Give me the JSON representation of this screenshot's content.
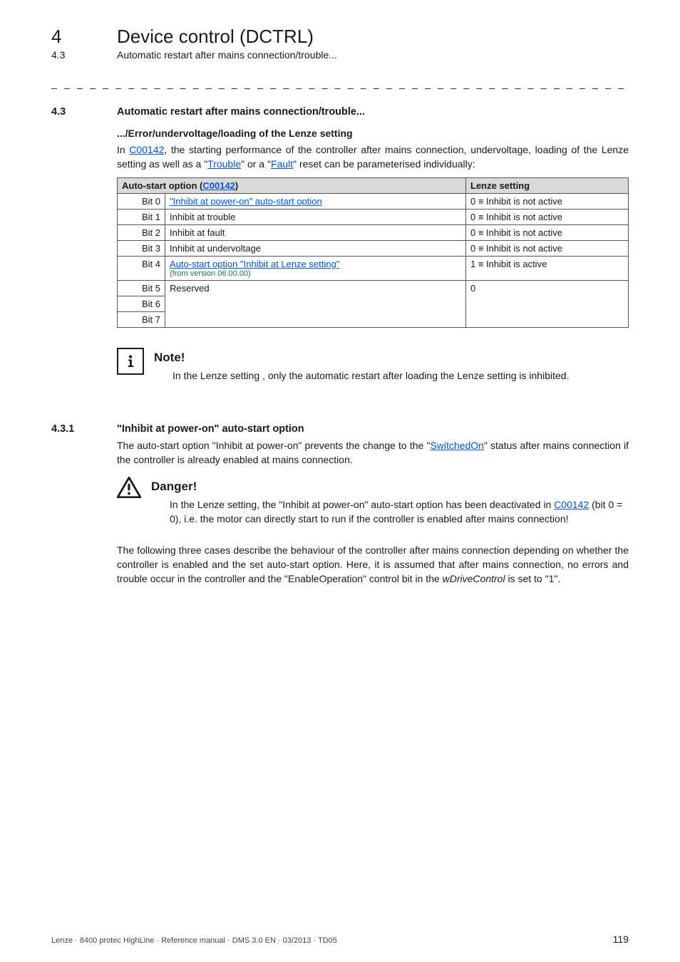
{
  "chapter": {
    "number": "4",
    "title": "Device control (DCTRL)"
  },
  "header_sub": {
    "number": "4.3",
    "title": "Automatic restart after mains connection/trouble..."
  },
  "dash_rule": "_ _ _ _ _ _ _ _ _ _ _ _ _ _ _ _ _ _ _ _ _ _ _ _ _ _ _ _ _ _ _ _ _ _ _ _ _ _ _ _ _ _ _ _ _ _ _ _ _ _ _ _ _ _ _ _ _ _ _ _ _ _ _ _",
  "section_4_3": {
    "num": "4.3",
    "title": "Automatic restart after mains connection/trouble...",
    "subheading": ".../Error/undervoltage/loading of the Lenze setting",
    "intro_pre": "In ",
    "intro_link1": "C00142",
    "intro_mid1": ", the starting performance of the controller after mains connection, undervoltage, loading of the Lenze setting as well as a \"",
    "intro_link2": "Trouble",
    "intro_mid2": "\" or a \"",
    "intro_link3": "Fault",
    "intro_post": "\" reset can be parameterised individually:"
  },
  "table": {
    "hdr_left_pre": "Auto-start option (",
    "hdr_left_link": "C00142",
    "hdr_left_post": ")",
    "hdr_right": "Lenze setting",
    "rows": {
      "r0": {
        "bit": "Bit 0",
        "desc_link": "\"Inhibit at power-on\" auto-start option",
        "setting": "0 ≡ Inhibit is not active"
      },
      "r1": {
        "bit": "Bit 1",
        "desc": "Inhibit at trouble",
        "setting": "0 ≡ Inhibit is not active"
      },
      "r2": {
        "bit": "Bit 2",
        "desc": "Inhibit at fault",
        "setting": "0 ≡ Inhibit is not active"
      },
      "r3": {
        "bit": "Bit 3",
        "desc": "Inhibit at undervoltage",
        "setting": "0 ≡ Inhibit is not active"
      },
      "r4": {
        "bit": "Bit 4",
        "desc_link": "Auto-start option \"Inhibit at Lenze setting\"",
        "version": "(from version 06.00.00)",
        "setting": "1 ≡ Inhibit is active"
      },
      "r5": {
        "bit": "Bit 5",
        "desc": "Reserved",
        "setting": "0"
      },
      "r6": {
        "bit": "Bit 6"
      },
      "r7": {
        "bit": "Bit 7"
      }
    }
  },
  "note": {
    "title": "Note!",
    "body": "In the Lenze setting , only the automatic restart after loading the Lenze setting is inhibited."
  },
  "section_4_3_1": {
    "num": "4.3.1",
    "title": "\"Inhibit at power-on\" auto-start option",
    "para_pre": "The auto-start option \"Inhibit at power-on\" prevents the change to the \"",
    "para_link": "SwitchedOn",
    "para_post": "\" status after mains connection if the controller is already enabled at mains connection."
  },
  "danger": {
    "title": "Danger!",
    "body_pre": "In the Lenze setting, the  \"Inhibit at power-on\" auto-start option has been deactivated in ",
    "body_link": "C00142",
    "body_post": " (bit 0 = 0), i.e. the motor can directly start to run if the controller is enabled after mains connection!"
  },
  "closing": {
    "l1_pre": "The following three cases describe the behaviour of the controller after mains connection depending on whether the controller is enabled and the set auto-start option. Here, it is assumed that after mains connection, no errors and trouble occur in the controller and the \"EnableOperation\" control bit in the ",
    "l1_em": "wDriveControl",
    "l1_post": " is set to \"1\"."
  },
  "footer": {
    "left": "Lenze · 8400 protec HighLine · Reference manual · DMS 3.0 EN · 03/2013 · TD05",
    "page": "119"
  }
}
